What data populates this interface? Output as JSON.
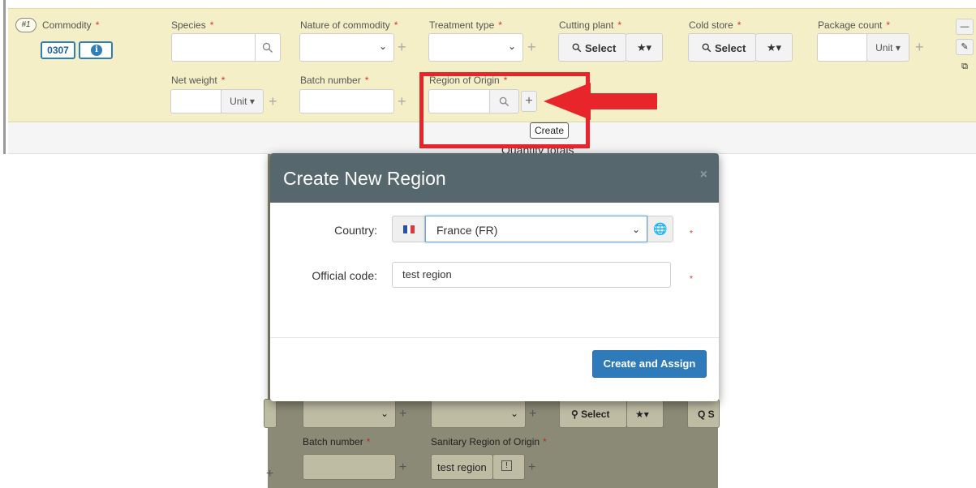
{
  "commodity_panel": {
    "sequence": "#1",
    "commodity_label": "Commodity",
    "commodity_code": "0307",
    "species_label": "Species",
    "nature_label": "Nature of commodity",
    "treatment_label": "Treatment type",
    "cutting_plant_label": "Cutting plant",
    "cold_store_label": "Cold store",
    "package_count_label": "Package count",
    "net_weight_label": "Net weight",
    "batch_label": "Batch number",
    "region_label": "Region of Origin",
    "select_label": "Select",
    "unit_label": "Unit",
    "required_mark": "*",
    "tooltip": "Create",
    "quantity_totals": "Quantity totals"
  },
  "modal": {
    "title": "Create New Region",
    "close": "×",
    "country_label": "Country:",
    "country_value": "France (FR)",
    "official_code_label": "Official code:",
    "official_code_value": "test region",
    "required_mark": "*",
    "submit_label": "Create and Assign"
  },
  "background_form": {
    "select_label": "Select",
    "batch_label": "Batch number",
    "sanitary_region_label": "Sanitary Region of Origin",
    "region_value": "test region",
    "required_mark": "*"
  },
  "colors": {
    "panel_bg": "#f4efc7",
    "modal_header": "#56686e",
    "primary_button": "#2f7ab8",
    "highlight_red": "#e8252b",
    "required_star": "#d9332b"
  },
  "icons": {
    "search": "search-icon",
    "plus": "plus-icon",
    "star": "star-icon",
    "info": "info-icon",
    "globe": "globe-icon",
    "edit": "pencil-icon",
    "copy": "copy-icon",
    "minus": "minus-icon",
    "flag": "france-flag-icon",
    "arrow": "red-arrow-annotation"
  }
}
